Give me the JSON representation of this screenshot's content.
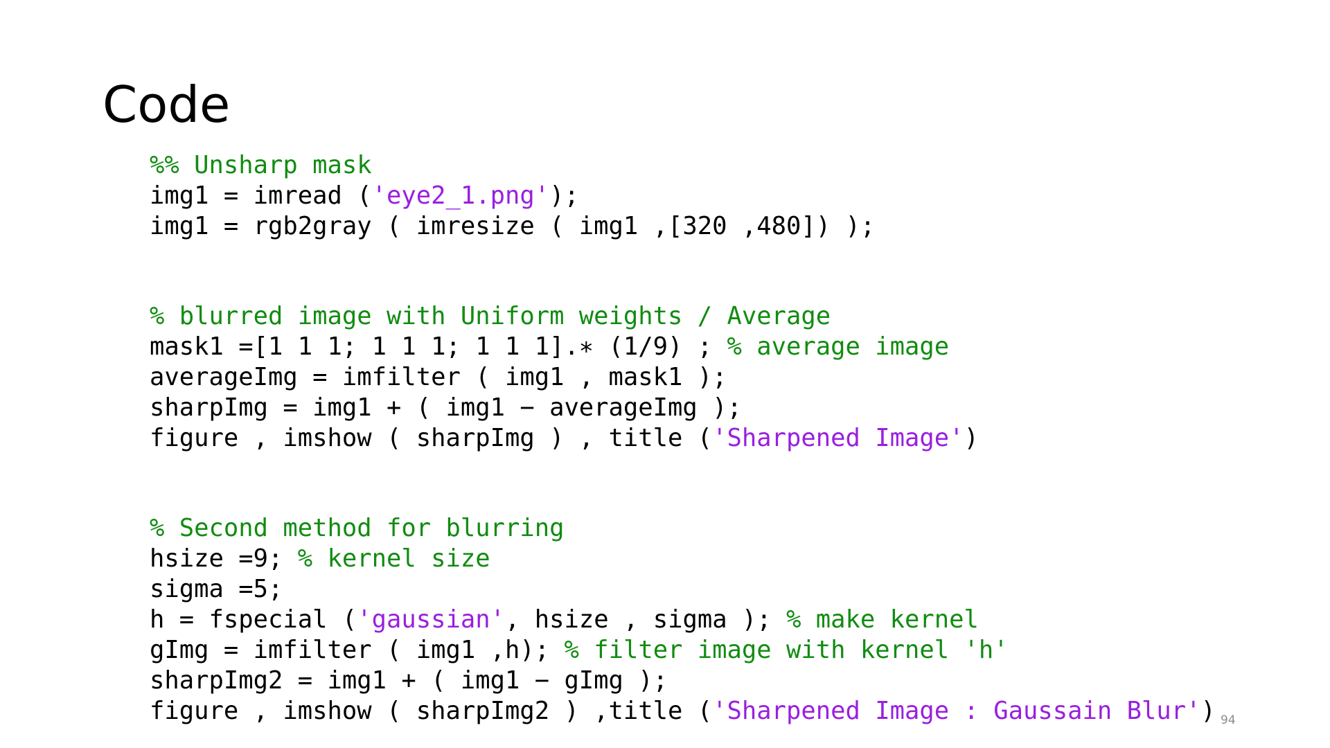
{
  "slide": {
    "title": "Code",
    "page_number": "94"
  },
  "colors": {
    "code": "#000000",
    "comment": "#118c11",
    "string": "#9a1fe0",
    "page_number": "#8c8c8c"
  },
  "code_lines": [
    [
      {
        "t": "%% Unsharp mask",
        "k": "comment"
      }
    ],
    [
      {
        "t": "img1 = imread (",
        "k": "code"
      },
      {
        "t": "'eye2_1.png'",
        "k": "string"
      },
      {
        "t": ");",
        "k": "code"
      }
    ],
    [
      {
        "t": "img1 = rgb2gray ( imresize ( img1 ,[320 ,480]) );",
        "k": "code"
      }
    ],
    [],
    [],
    [
      {
        "t": "% blurred image with Uniform weights / Average",
        "k": "comment"
      }
    ],
    [
      {
        "t": "mask1 =[1 1 1; 1 1 1; 1 1 1].∗ (1/9) ; ",
        "k": "code"
      },
      {
        "t": "% average image",
        "k": "comment"
      }
    ],
    [
      {
        "t": "averageImg = imfilter ( img1 , mask1 );",
        "k": "code"
      }
    ],
    [
      {
        "t": "sharpImg = img1 + ( img1 − averageImg );",
        "k": "code"
      }
    ],
    [
      {
        "t": "figure , imshow ( sharpImg ) , title (",
        "k": "code"
      },
      {
        "t": "'Sharpened Image'",
        "k": "string"
      },
      {
        "t": ")",
        "k": "code"
      }
    ],
    [],
    [],
    [
      {
        "t": "% Second method for blurring",
        "k": "comment"
      }
    ],
    [
      {
        "t": "hsize =9; ",
        "k": "code"
      },
      {
        "t": "% kernel size",
        "k": "comment"
      }
    ],
    [
      {
        "t": "sigma =5;",
        "k": "code"
      }
    ],
    [
      {
        "t": "h = fspecial (",
        "k": "code"
      },
      {
        "t": "'gaussian'",
        "k": "string"
      },
      {
        "t": ", hsize , sigma ); ",
        "k": "code"
      },
      {
        "t": "% make kernel",
        "k": "comment"
      }
    ],
    [
      {
        "t": "gImg = imfilter ( img1 ,h); ",
        "k": "code"
      },
      {
        "t": "% filter image with kernel 'h'",
        "k": "comment"
      }
    ],
    [
      {
        "t": "sharpImg2 = img1 + ( img1 − gImg );",
        "k": "code"
      }
    ],
    [
      {
        "t": "figure , imshow ( sharpImg2 ) ,title (",
        "k": "code"
      },
      {
        "t": "'Sharpened Image : Gaussain Blur'",
        "k": "string"
      },
      {
        "t": ")",
        "k": "code"
      }
    ]
  ]
}
